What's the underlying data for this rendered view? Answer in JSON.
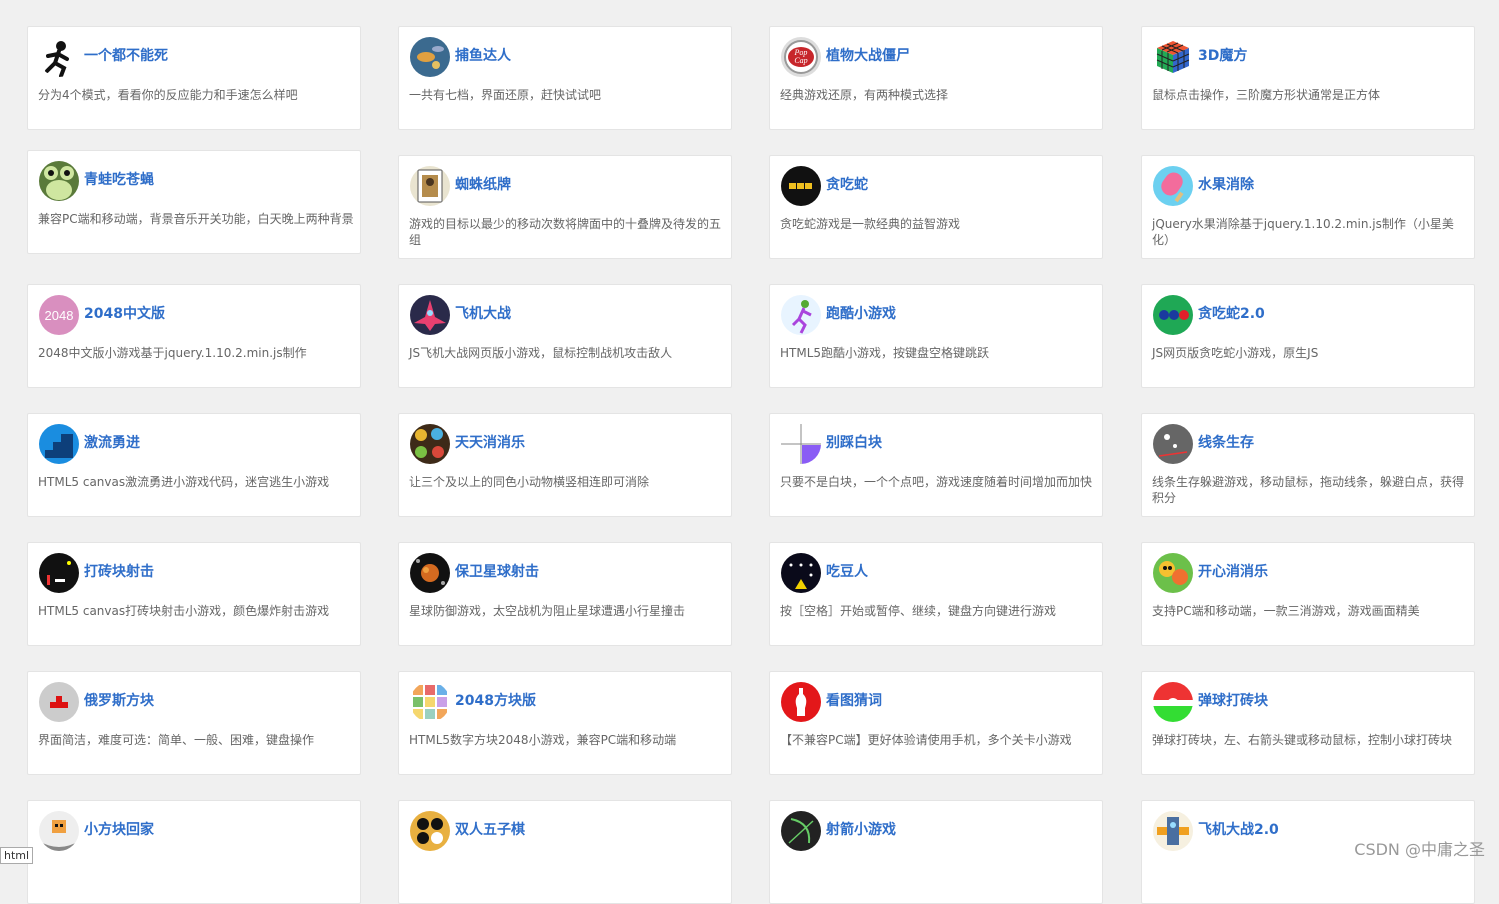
{
  "games": [
    {
      "title": "一个都不能死",
      "desc": "分为4个模式，看看你的反应能力和手速怎么样吧",
      "icon": "running-man-icon"
    },
    {
      "title": "捕鱼达人",
      "desc": "一共有七档，界面还原，赶快试试吧",
      "icon": "fishing-icon"
    },
    {
      "title": "植物大战僵尸",
      "desc": "经典游戏还原，有两种模式选择",
      "icon": "popcap-logo-icon"
    },
    {
      "title": "3D魔方",
      "desc": "鼠标点击操作，三阶魔方形状通常是正方体",
      "icon": "rubiks-cube-icon"
    },
    {
      "title": "青蛙吃苍蝇",
      "desc": "兼容PC端和移动端，背景音乐开关功能，白天晚上两种背景",
      "icon": "frog-icon"
    },
    {
      "title": "蜘蛛纸牌",
      "desc": "游戏的目标以最少的移动次数将牌面中的十叠牌及待发的五组",
      "icon": "playing-card-icon"
    },
    {
      "title": "贪吃蛇",
      "desc": "贪吃蛇游戏是一款经典的益智游戏",
      "icon": "snake-icon"
    },
    {
      "title": "水果消除",
      "desc": "jQuery水果消除基于jquery.1.10.2.min.js制作（小星美化）",
      "icon": "popsicle-icon"
    },
    {
      "title": "2048中文版",
      "desc": "2048中文版小游戏基于jquery.1.10.2.min.js制作",
      "icon": "2048-icon",
      "icon_text": "2048"
    },
    {
      "title": "飞机大战",
      "desc": "JS飞机大战网页版小游戏，鼠标控制战机攻击敌人",
      "icon": "fighter-plane-icon"
    },
    {
      "title": "跑酷小游戏",
      "desc": "HTML5跑酷小游戏，按键盘空格键跳跃",
      "icon": "parkour-runner-icon"
    },
    {
      "title": "贪吃蛇2.0",
      "desc": "JS网页版贪吃蛇小游戏，原生JS",
      "icon": "snake-dots-icon"
    },
    {
      "title": "激流勇进",
      "desc": "HTML5 canvas激流勇进小游戏代码，迷宫逃生小游戏",
      "icon": "stairs-icon"
    },
    {
      "title": "天天消消乐",
      "desc": "让三个及以上的同色小动物横竖相连即可消除",
      "icon": "animal-match-icon"
    },
    {
      "title": "别踩白块",
      "desc": "只要不是白块，一个个点吧，游戏速度随着时间增加而加快",
      "icon": "piano-tiles-icon"
    },
    {
      "title": "线条生存",
      "desc": "线条生存躲避游戏，移动鼠标，拖动线条，躲避白点，获得积分",
      "icon": "line-survival-icon"
    },
    {
      "title": "打砖块射击",
      "desc": "HTML5 canvas打砖块射击小游戏，颜色爆炸射击游戏",
      "icon": "brick-shooter-icon"
    },
    {
      "title": "保卫星球射击",
      "desc": "星球防御游戏，太空战机为阻止星球遭遇小行星撞击",
      "icon": "planet-icon"
    },
    {
      "title": "吃豆人",
      "desc": "按［空格］开始或暂停、继续，键盘方向键进行游戏",
      "icon": "pacman-icon"
    },
    {
      "title": "开心消消乐",
      "desc": "支持PC端和移动端，一款三消游戏，游戏画面精美",
      "icon": "happy-match-icon"
    },
    {
      "title": "俄罗斯方块",
      "desc": "界面简洁，难度可选：简单、一般、困难，键盘操作",
      "icon": "tetris-icon"
    },
    {
      "title": "2048方块版",
      "desc": "HTML5数字方块2048小游戏，兼容PC端和移动端",
      "icon": "grid-blocks-icon"
    },
    {
      "title": "看图猜词",
      "desc": "【不兼容PC端】更好体验请使用手机，多个关卡小游戏",
      "icon": "cola-bottle-icon"
    },
    {
      "title": "弹球打砖块",
      "desc": "弹球打砖块，左、右箭头键或移动鼠标，控制小球打砖块",
      "icon": "breakout-ball-icon"
    },
    {
      "title": "小方块回家",
      "desc": "",
      "icon": "little-block-icon"
    },
    {
      "title": "双人五子棋",
      "desc": "",
      "icon": "gomoku-icon"
    },
    {
      "title": "射箭小游戏",
      "desc": "",
      "icon": "archery-icon"
    },
    {
      "title": "飞机大战2.0",
      "desc": "",
      "icon": "robot-plane-icon"
    }
  ],
  "watermark": "CSDN @中庸之圣",
  "status_tag": "html"
}
